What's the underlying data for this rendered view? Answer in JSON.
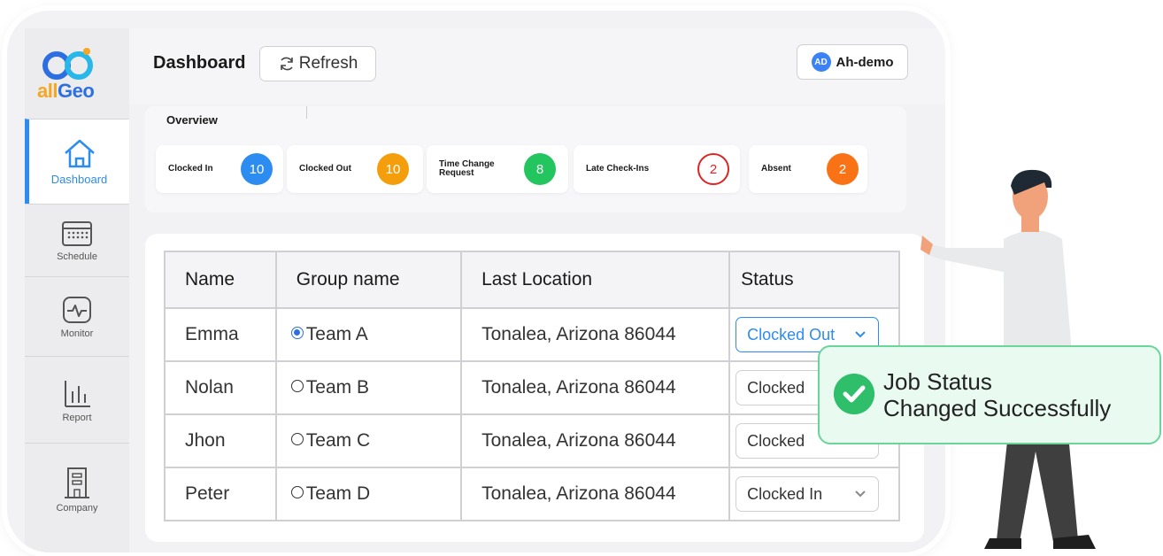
{
  "brand": {
    "logo_all": "all",
    "logo_geo": "Geo"
  },
  "sidebar": {
    "items": [
      {
        "label": "Dashboard",
        "icon": "home-icon"
      },
      {
        "label": "Schedule",
        "icon": "calendar-icon"
      },
      {
        "label": "Monitor",
        "icon": "monitor-icon"
      },
      {
        "label": "Report",
        "icon": "bar-chart-icon"
      },
      {
        "label": "Company",
        "icon": "building-icon"
      }
    ]
  },
  "header": {
    "title": "Dashboard",
    "refresh_label": "Refresh",
    "user_initials": "AD",
    "user_name": "Ah-demo"
  },
  "overview": {
    "title": "Overview",
    "cards": [
      {
        "label": "Clocked In",
        "count": "10",
        "color": "#2d8cf0"
      },
      {
        "label": "Clocked Out",
        "count": "10",
        "color": "#f59e0b"
      },
      {
        "label": "Time Change Request",
        "count": "8",
        "color": "#22c55e"
      },
      {
        "label": "Late Check-Ins",
        "count": "2",
        "color": "#dc2626"
      },
      {
        "label": "Absent",
        "count": "2",
        "color": "#f97316"
      }
    ]
  },
  "table": {
    "headers": [
      "Name",
      "Group name",
      "Last Location",
      "Status"
    ],
    "rows": [
      {
        "name": "Emma",
        "group": "Team A",
        "selected": true,
        "location": "Tonalea, Arizona 86044",
        "status": "Clocked Out"
      },
      {
        "name": "Nolan",
        "group": "Team B",
        "selected": false,
        "location": "Tonalea, Arizona 86044",
        "status": "Clocked"
      },
      {
        "name": "Jhon",
        "group": "Team C",
        "selected": false,
        "location": "Tonalea, Arizona 86044",
        "status": "Clocked"
      },
      {
        "name": "Peter",
        "group": "Team D",
        "selected": false,
        "location": "Tonalea, Arizona 86044",
        "status": "Clocked In"
      }
    ]
  },
  "toast": {
    "line1": "Job Status",
    "line2": "Changed Successfully",
    "icon": "check-circle-icon",
    "color": "#2fbf6a"
  }
}
